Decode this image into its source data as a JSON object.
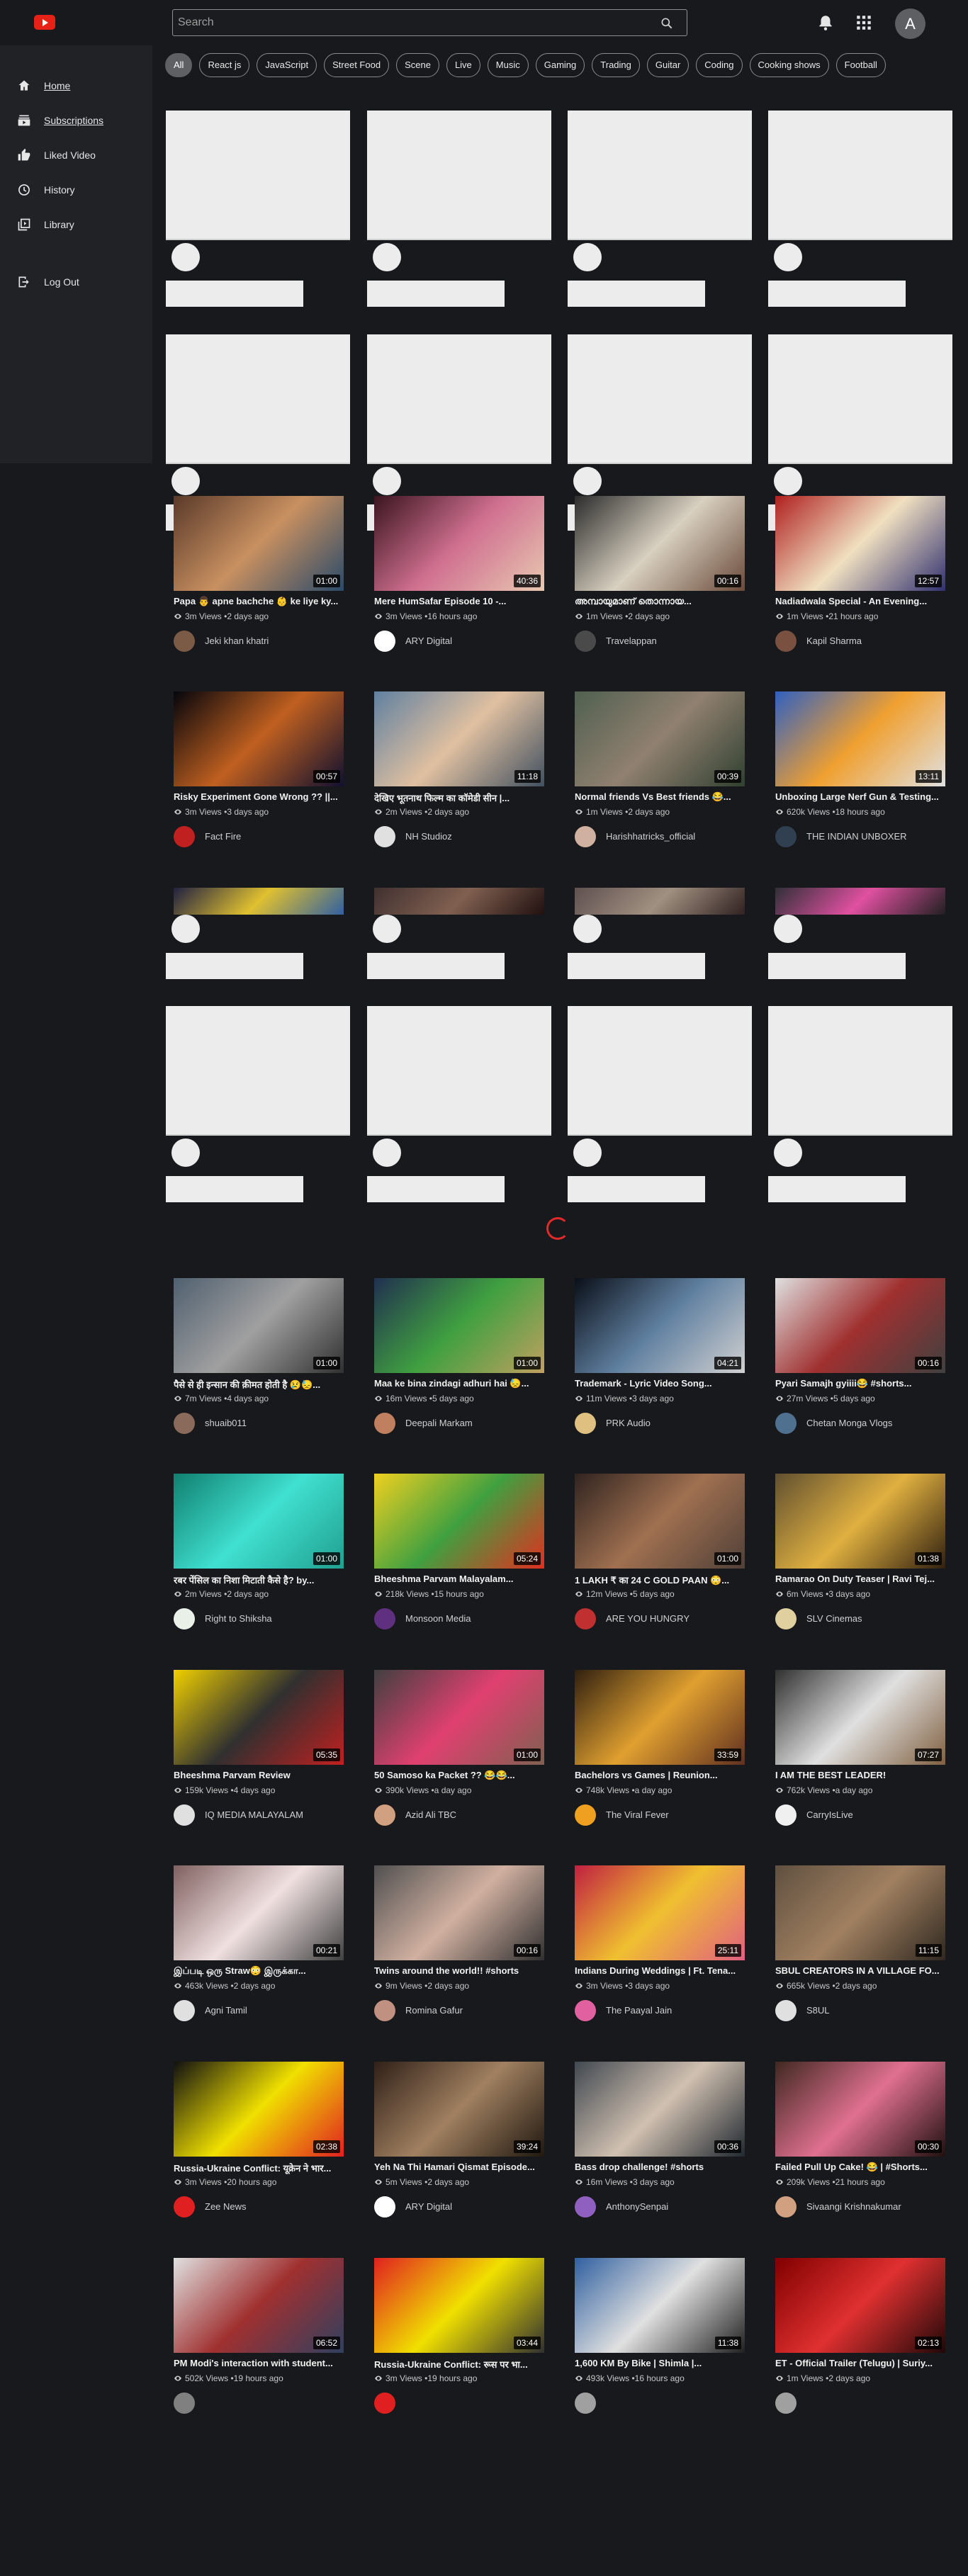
{
  "header": {
    "search_placeholder": "Search",
    "avatar_initial": "A"
  },
  "chips": [
    "All",
    "React js",
    "JavaScript",
    "Street Food",
    "Scene",
    "Live",
    "Music",
    "Gaming",
    "Trading",
    "Guitar",
    "Coding",
    "Cooking shows",
    "Football"
  ],
  "sidebar": {
    "items": [
      {
        "label": "Home",
        "icon": "home-icon"
      },
      {
        "label": "Subscriptions",
        "icon": "subscriptions-icon"
      },
      {
        "label": "Liked Video",
        "icon": "thumbs-up-icon"
      },
      {
        "label": "History",
        "icon": "history-icon"
      },
      {
        "label": "Library",
        "icon": "library-icon"
      },
      {
        "label": "Log Out",
        "icon": "logout-icon"
      }
    ]
  },
  "videos": [
    {
      "title": "Papa 👨 apne bachche 👶 ke liye ky...",
      "meta": "3m Views •2 days ago",
      "channel": "Jeki khan khatri",
      "duration": "01:00",
      "colors": [
        "#5a3a2a",
        "#c89060",
        "#2a4a6a"
      ],
      "av": "#7b5b45"
    },
    {
      "title": "Mere HumSafar Episode 10 -...",
      "meta": "3m Views •16 hours ago",
      "channel": "ARY Digital",
      "duration": "40:36",
      "colors": [
        "#3b1520",
        "#d07090",
        "#e8c8b0"
      ],
      "av": "#ffffff"
    },
    {
      "title": "അമ്പായുമാണ് തൊന്നായ...",
      "meta": "1m Views •2 days ago",
      "channel": "Travelappan",
      "duration": "00:16",
      "colors": [
        "#2c2c2c",
        "#d8d0c0",
        "#6a4a3a"
      ],
      "av": "#4a4a4a"
    },
    {
      "title": "Nadiadwala Special - An Evening...",
      "meta": "1m Views •21 hours ago",
      "channel": "Kapil Sharma",
      "duration": "12:57",
      "colors": [
        "#b02020",
        "#f0e0c0",
        "#303070"
      ],
      "av": "#7a5040"
    },
    {
      "title": "Risky Experiment Gone Wrong ?? ||...",
      "meta": "3m Views •3 days ago",
      "channel": "Fact Fire",
      "duration": "00:57",
      "colors": [
        "#05050c",
        "#c06020",
        "#101030"
      ],
      "av": "#c02020"
    },
    {
      "title": "देखिए भूतनाथ फिल्म का कॉमेडी सीन |...",
      "meta": "2m Views •2 days ago",
      "channel": "NH Studioz",
      "duration": "11:18",
      "colors": [
        "#6080a0",
        "#e0c0a0",
        "#405060"
      ],
      "av": "#e0e0e0"
    },
    {
      "title": "Normal friends Vs Best friends 😂...",
      "meta": "1m Views •2 days ago",
      "channel": "Harishhatricks_official",
      "duration": "00:39",
      "colors": [
        "#506050",
        "#908070",
        "#304030"
      ],
      "av": "#d0b0a0"
    },
    {
      "title": "Unboxing Large Nerf Gun & Testing...",
      "meta": "620k Views •18 hours ago",
      "channel": "THE INDIAN UNBOXER",
      "duration": "13:11",
      "colors": [
        "#3060c0",
        "#f0a030",
        "#e0e0e0"
      ],
      "av": "#304050"
    },
    {
      "title": "पैसे से ही इन्सान की क़ीमत होती है 😢😓...",
      "meta": "7m Views •4 days ago",
      "channel": "shuaib011",
      "duration": "01:00",
      "colors": [
        "#506070",
        "#a0a0a0",
        "#303030"
      ],
      "av": "#8a6a5a"
    },
    {
      "title": "Maa ke bina zindagi adhuri hai 😓...",
      "meta": "16m Views •5 days ago",
      "channel": "Deepali Markam",
      "duration": "01:00",
      "colors": [
        "#203050",
        "#40a040",
        "#c0a060"
      ],
      "av": "#c08060"
    },
    {
      "title": "Trademark - Lyric Video Song...",
      "meta": "11m Views •3 days ago",
      "channel": "PRK Audio",
      "duration": "04:21",
      "colors": [
        "#0a0f18",
        "#6080a0",
        "#d0d0d0"
      ],
      "av": "#e0c080"
    },
    {
      "title": "Pyari Samajh gyiiii😂 #shorts...",
      "meta": "27m Views •5 days ago",
      "channel": "Chetan Monga Vlogs",
      "duration": "00:16",
      "colors": [
        "#e0e0e0",
        "#a03030",
        "#404040"
      ],
      "av": "#507090"
    },
    {
      "title": "रबर पेंसिल का निशा मिटाती कैसे है? by...",
      "meta": "2m Views •2 days ago",
      "channel": "Right to Shiksha",
      "duration": "01:00",
      "colors": [
        "#108070",
        "#40e0d0",
        "#20a090"
      ],
      "av": "#e8f0e8"
    },
    {
      "title": "Bheeshma Parvam Malayalam...",
      "meta": "218k Views •15 hours ago",
      "channel": "Monsoon Media",
      "duration": "05:24",
      "colors": [
        "#f0d020",
        "#40a040",
        "#e03020"
      ],
      "av": "#603080"
    },
    {
      "title": "1 LAKH ₹ का 24 C GOLD PAAN 😳...",
      "meta": "12m Views •5 days ago",
      "channel": "ARE YOU HUNGRY",
      "duration": "01:00",
      "colors": [
        "#302420",
        "#a07050",
        "#504038"
      ],
      "av": "#c03030"
    },
    {
      "title": "Ramarao On Duty Teaser | Ravi Tej...",
      "meta": "6m Views •3 days ago",
      "channel": "SLV Cinemas",
      "duration": "01:38",
      "colors": [
        "#605030",
        "#e0b040",
        "#302010"
      ],
      "av": "#e0d0a0"
    },
    {
      "title": "Bheeshma Parvam Review",
      "meta": "159k Views •4 days ago",
      "channel": "IQ MEDIA MALAYALAM",
      "duration": "05:35",
      "colors": [
        "#f0d000",
        "#303030",
        "#c02020"
      ],
      "av": "#e0e0e0"
    },
    {
      "title": "50 Samoso ka Packet ?? 😂😂...",
      "meta": "390k Views •a day ago",
      "channel": "Azid Ali TBC",
      "duration": "01:00",
      "colors": [
        "#404040",
        "#e04070",
        "#806050"
      ],
      "av": "#d0a080"
    },
    {
      "title": "Bachelors vs Games | Reunion...",
      "meta": "748k Views •a day ago",
      "channel": "The Viral Fever",
      "duration": "33:59",
      "colors": [
        "#302010",
        "#e0a030",
        "#603020"
      ],
      "av": "#f0a020"
    },
    {
      "title": "I AM THE BEST LEADER!",
      "meta": "762k Views •a day ago",
      "channel": "CarryIsLive",
      "duration": "07:27",
      "colors": [
        "#303030",
        "#e0e0e0",
        "#806040"
      ],
      "av": "#f0f0f0"
    },
    {
      "title": "இப்படி ஒரு Straw😳 இருக்கா...",
      "meta": "463k Views •2 days ago",
      "channel": "Agni Tamil",
      "duration": "00:21",
      "colors": [
        "#806060",
        "#f0e0e0",
        "#404040"
      ],
      "av": "#e0e0e0"
    },
    {
      "title": "Twins around the world!! #shorts",
      "meta": "9m Views •2 days ago",
      "channel": "Romina Gafur",
      "duration": "00:16",
      "colors": [
        "#505050",
        "#d0b0a0",
        "#303030"
      ],
      "av": "#c09080"
    },
    {
      "title": "Indians During Weddings | Ft. Tena...",
      "meta": "3m Views •3 days ago",
      "channel": "The Paayal Jain",
      "duration": "25:11",
      "colors": [
        "#c02040",
        "#f0c030",
        "#e06080"
      ],
      "av": "#e060a0"
    },
    {
      "title": "SBUL CREATORS IN A VILLAGE FO...",
      "meta": "665k Views •2 days ago",
      "channel": "S8UL",
      "duration": "11:15",
      "colors": [
        "#605040",
        "#a08060",
        "#302820"
      ],
      "av": "#e0e0e0"
    },
    {
      "title": "Russia-Ukraine Conflict: यूक्रेन ने भार...",
      "meta": "3m Views •20 hours ago",
      "channel": "Zee News",
      "duration": "02:38",
      "colors": [
        "#101010",
        "#f0e000",
        "#e02020"
      ],
      "av": "#e02020"
    },
    {
      "title": "Yeh Na Thi Hamari Qismat Episode...",
      "meta": "5m Views •2 days ago",
      "channel": "ARY Digital",
      "duration": "39:24",
      "colors": [
        "#302018",
        "#a08060",
        "#201810"
      ],
      "av": "#ffffff"
    },
    {
      "title": "Bass drop challenge! #shorts",
      "meta": "16m Views •3 days ago",
      "channel": "AnthonySenpai",
      "duration": "00:36",
      "colors": [
        "#404850",
        "#d0c0b0",
        "#202830"
      ],
      "av": "#9060c0"
    },
    {
      "title": "Failed Pull Up Cake! 😂 | #Shorts...",
      "meta": "209k Views •21 hours ago",
      "channel": "Sivaangi Krishnakumar",
      "duration": "00:30",
      "colors": [
        "#402820",
        "#e07090",
        "#201010"
      ],
      "av": "#d0a080"
    },
    {
      "title": "PM Modi's interaction with student...",
      "meta": "502k Views •19 hours ago",
      "channel": "",
      "duration": "06:52",
      "colors": [
        "#e0e0e0",
        "#a03030",
        "#304060"
      ],
      "av": "#808080"
    },
    {
      "title": "Russia-Ukraine Conflict: रूस पर भा...",
      "meta": "3m Views •19 hours ago",
      "channel": "",
      "duration": "03:44",
      "colors": [
        "#e02020",
        "#f0e000",
        "#303030"
      ],
      "av": "#e02020"
    },
    {
      "title": "1,600 KM By Bike | Shimla |...",
      "meta": "493k Views •16 hours ago",
      "channel": "",
      "duration": "11:38",
      "colors": [
        "#3060a0",
        "#e0e0e0",
        "#202020"
      ],
      "av": "#a0a0a0"
    },
    {
      "title": "ET - Official Trailer (Telugu) | Suriy...",
      "meta": "1m Views •2 days ago",
      "channel": "",
      "duration": "02:13",
      "colors": [
        "#800000",
        "#e03030",
        "#200808"
      ],
      "av": "#a0a0a0"
    }
  ],
  "peek_thumbs": [
    {
      "colors": [
        "#202040",
        "#e0c030",
        "#3060a0"
      ]
    },
    {
      "colors": [
        "#403030",
        "#806050",
        "#201010"
      ]
    },
    {
      "colors": [
        "#605050",
        "#a09080",
        "#302020"
      ]
    },
    {
      "colors": [
        "#303038",
        "#e050a0",
        "#202020"
      ]
    }
  ]
}
